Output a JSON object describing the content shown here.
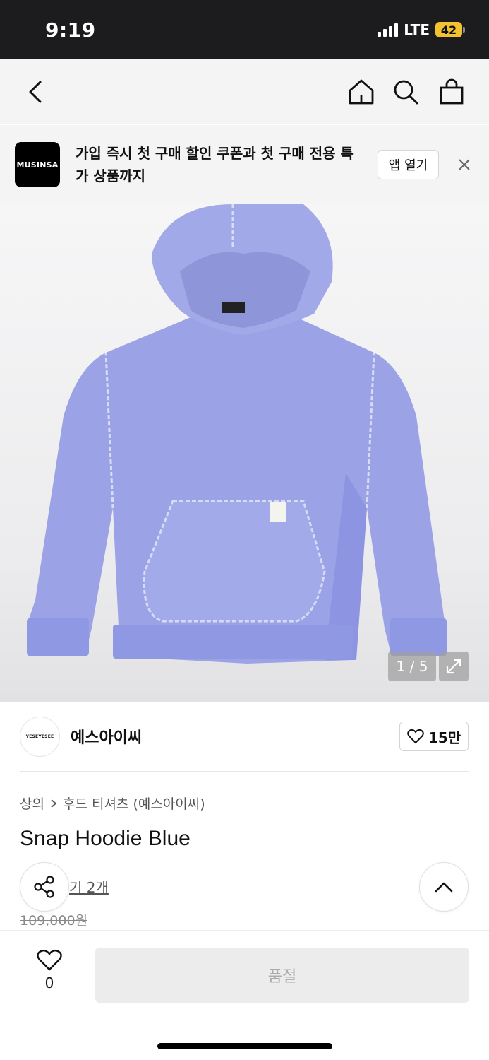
{
  "status_bar": {
    "time": "9:19",
    "network": "LTE",
    "battery": "42"
  },
  "nav": {
    "back_icon": "chevron-left-icon",
    "home_icon": "home-icon",
    "search_icon": "search-icon",
    "cart_icon": "shopping-bag-icon"
  },
  "banner": {
    "logo_text": "MUSINSA",
    "text": "가입 즉시 첫 구매 할인 쿠폰과 첫 구매 전용 특가 상품까지",
    "open_app_label": "앱 열기",
    "close_icon": "close-icon"
  },
  "product_image": {
    "counter": "1 / 5",
    "product_color": "#9aa2e6"
  },
  "brand": {
    "logo_text": "YESEYESEE",
    "name": "예스아이씨",
    "likes": "15만"
  },
  "breadcrumb": {
    "category": "상의",
    "subcategory": "후드 티셔츠 (예스아이씨)"
  },
  "product": {
    "title": "Snap Hoodie Blue",
    "reviews_label": "기 2개",
    "original_price": "109,000원"
  },
  "bottom_bar": {
    "wish_count": "0",
    "soldout_label": "품절"
  },
  "colors": {
    "status_bar_bg": "#1c1c1e",
    "battery": "#f2c230",
    "soldout_bg": "#ececec"
  }
}
